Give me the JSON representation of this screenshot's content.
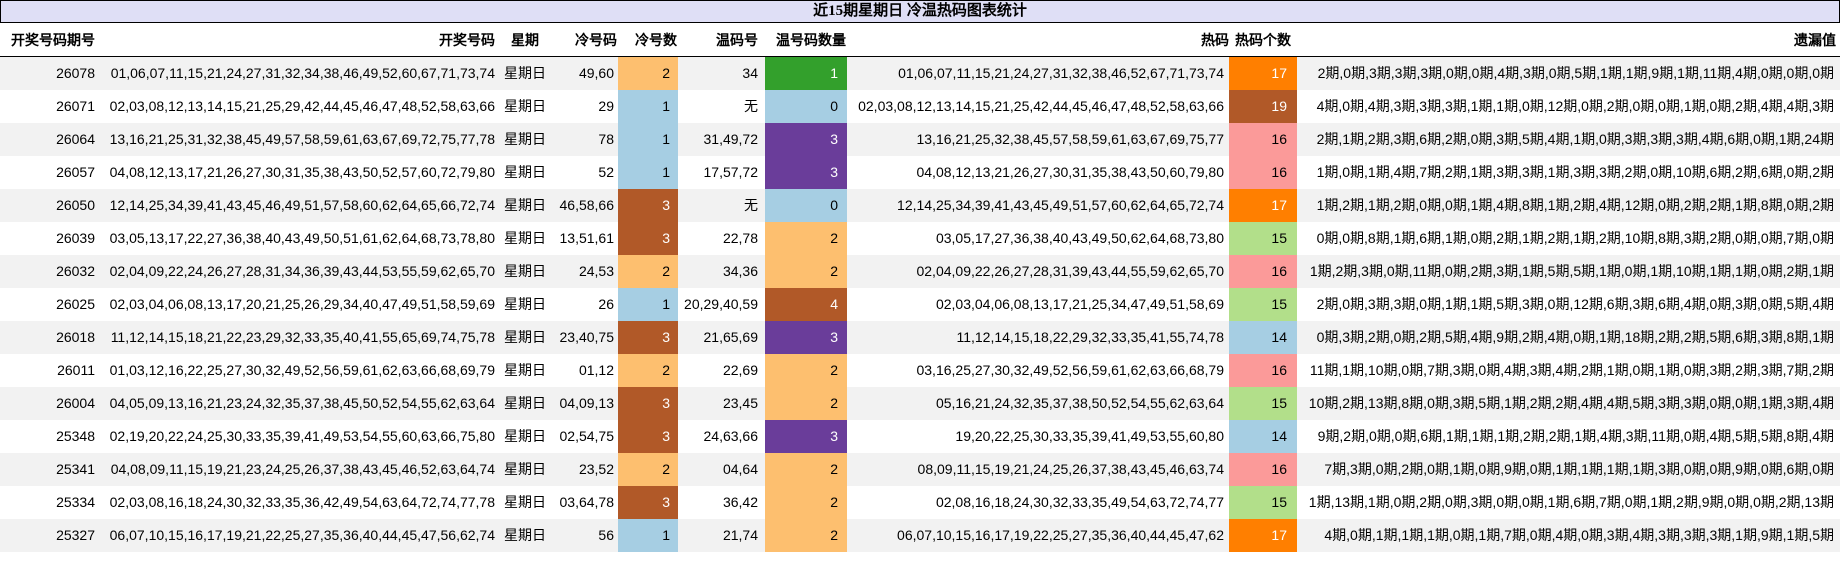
{
  "title": "近15期星期日 冷温热码图表统计",
  "columns": {
    "period": "开奖号码期号",
    "draw": "开奖号码",
    "week": "星期",
    "cold": "冷号码",
    "cold_n": "冷号数",
    "warm": "温码号",
    "warm_n": "温号码数量",
    "hot": "热码",
    "hot_n": "热码个数",
    "miss": "遗漏值"
  },
  "colors": {
    "title_bg": "#DFDFF6",
    "row_alt_bg": "#F2F2F2",
    "light_blue": "#A6CEE3",
    "light_orange": "#FDBF6F",
    "brown": "#B15928",
    "green": "#33A02C",
    "purple": "#6A3D9A",
    "light_green": "#B2DF8A",
    "salmon": "#FB9A99",
    "orange": "#FF7F00",
    "dark_backgrounds": [
      "#B15928",
      "#33A02C",
      "#6A3D9A",
      "#FF7F00"
    ]
  },
  "rows": [
    {
      "period": "26078",
      "draw": "01,06,07,11,15,21,24,27,31,32,34,38,46,49,52,60,67,71,73,74",
      "week": "星期日",
      "cold": "49,60",
      "cold_n": "2",
      "cold_color": "#FDBF6F",
      "warm": "34",
      "warm_n": "1",
      "warm_color": "#33A02C",
      "hot": "01,06,07,11,15,21,24,27,31,32,38,46,52,67,71,73,74",
      "hot_n": "17",
      "hot_color": "#FF7F00",
      "miss": "2期,0期,3期,3期,3期,0期,0期,4期,3期,0期,5期,1期,1期,9期,1期,11期,4期,0期,0期,0期"
    },
    {
      "period": "26071",
      "draw": "02,03,08,12,13,14,15,21,25,29,42,44,45,46,47,48,52,58,63,66",
      "week": "星期日",
      "cold": "29",
      "cold_n": "1",
      "cold_color": "#A6CEE3",
      "warm": "无",
      "warm_n": "0",
      "warm_color": "#A6CEE3",
      "hot": "02,03,08,12,13,14,15,21,25,42,44,45,46,47,48,52,58,63,66",
      "hot_n": "19",
      "hot_color": "#B15928",
      "miss": "4期,0期,4期,3期,3期,3期,1期,1期,0期,12期,0期,2期,0期,0期,1期,0期,2期,4期,4期,3期"
    },
    {
      "period": "26064",
      "draw": "13,16,21,25,31,32,38,45,49,57,58,59,61,63,67,69,72,75,77,78",
      "week": "星期日",
      "cold": "78",
      "cold_n": "1",
      "cold_color": "#A6CEE3",
      "warm": "31,49,72",
      "warm_n": "3",
      "warm_color": "#6A3D9A",
      "hot": "13,16,21,25,32,38,45,57,58,59,61,63,67,69,75,77",
      "hot_n": "16",
      "hot_color": "#FB9A99",
      "miss": "2期,1期,2期,3期,6期,2期,0期,3期,5期,4期,1期,0期,3期,3期,3期,4期,6期,0期,1期,24期"
    },
    {
      "period": "26057",
      "draw": "04,08,12,13,17,21,26,27,30,31,35,38,43,50,52,57,60,72,79,80",
      "week": "星期日",
      "cold": "52",
      "cold_n": "1",
      "cold_color": "#A6CEE3",
      "warm": "17,57,72",
      "warm_n": "3",
      "warm_color": "#6A3D9A",
      "hot": "04,08,12,13,21,26,27,30,31,35,38,43,50,60,79,80",
      "hot_n": "16",
      "hot_color": "#FB9A99",
      "miss": "1期,0期,1期,4期,7期,2期,1期,3期,3期,1期,3期,3期,2期,0期,10期,6期,2期,6期,0期,2期"
    },
    {
      "period": "26050",
      "draw": "12,14,25,34,39,41,43,45,46,49,51,57,58,60,62,64,65,66,72,74",
      "week": "星期日",
      "cold": "46,58,66",
      "cold_n": "3",
      "cold_color": "#B15928",
      "warm": "无",
      "warm_n": "0",
      "warm_color": "#A6CEE3",
      "hot": "12,14,25,34,39,41,43,45,49,51,57,60,62,64,65,72,74",
      "hot_n": "17",
      "hot_color": "#FF7F00",
      "miss": "1期,2期,1期,2期,0期,0期,1期,4期,8期,1期,2期,4期,12期,0期,2期,2期,1期,8期,0期,2期"
    },
    {
      "period": "26039",
      "draw": "03,05,13,17,22,27,36,38,40,43,49,50,51,61,62,64,68,73,78,80",
      "week": "星期日",
      "cold": "13,51,61",
      "cold_n": "3",
      "cold_color": "#B15928",
      "warm": "22,78",
      "warm_n": "2",
      "warm_color": "#FDBF6F",
      "hot": "03,05,17,27,36,38,40,43,49,50,62,64,68,73,80",
      "hot_n": "15",
      "hot_color": "#B2DF8A",
      "miss": "0期,0期,8期,1期,6期,1期,0期,2期,1期,2期,1期,2期,10期,8期,3期,2期,0期,0期,7期,0期"
    },
    {
      "period": "26032",
      "draw": "02,04,09,22,24,26,27,28,31,34,36,39,43,44,53,55,59,62,65,70",
      "week": "星期日",
      "cold": "24,53",
      "cold_n": "2",
      "cold_color": "#FDBF6F",
      "warm": "34,36",
      "warm_n": "2",
      "warm_color": "#FDBF6F",
      "hot": "02,04,09,22,26,27,28,31,39,43,44,55,59,62,65,70",
      "hot_n": "16",
      "hot_color": "#FB9A99",
      "miss": "1期,2期,3期,0期,11期,0期,2期,3期,1期,5期,5期,1期,0期,1期,10期,1期,1期,0期,2期,1期"
    },
    {
      "period": "26025",
      "draw": "02,03,04,06,08,13,17,20,21,25,26,29,34,40,47,49,51,58,59,69",
      "week": "星期日",
      "cold": "26",
      "cold_n": "1",
      "cold_color": "#A6CEE3",
      "warm": "20,29,40,59",
      "warm_n": "4",
      "warm_color": "#B15928",
      "hot": "02,03,04,06,08,13,17,21,25,34,47,49,51,58,69",
      "hot_n": "15",
      "hot_color": "#B2DF8A",
      "miss": "2期,0期,3期,3期,0期,1期,1期,5期,3期,0期,12期,6期,3期,6期,4期,0期,3期,0期,5期,4期"
    },
    {
      "period": "26018",
      "draw": "11,12,14,15,18,21,22,23,29,32,33,35,40,41,55,65,69,74,75,78",
      "week": "星期日",
      "cold": "23,40,75",
      "cold_n": "3",
      "cold_color": "#B15928",
      "warm": "21,65,69",
      "warm_n": "3",
      "warm_color": "#6A3D9A",
      "hot": "11,12,14,15,18,22,29,32,33,35,41,55,74,78",
      "hot_n": "14",
      "hot_color": "#A6CEE3",
      "miss": "0期,3期,2期,0期,2期,5期,4期,9期,2期,4期,0期,1期,18期,2期,2期,5期,6期,3期,8期,1期"
    },
    {
      "period": "26011",
      "draw": "01,03,12,16,22,25,27,30,32,49,52,56,59,61,62,63,66,68,69,79",
      "week": "星期日",
      "cold": "01,12",
      "cold_n": "2",
      "cold_color": "#FDBF6F",
      "warm": "22,69",
      "warm_n": "2",
      "warm_color": "#FDBF6F",
      "hot": "03,16,25,27,30,32,49,52,56,59,61,62,63,66,68,79",
      "hot_n": "16",
      "hot_color": "#FB9A99",
      "miss": "11期,1期,10期,0期,7期,3期,0期,4期,3期,4期,2期,1期,0期,1期,0期,3期,2期,3期,7期,2期"
    },
    {
      "period": "26004",
      "draw": "04,05,09,13,16,21,23,24,32,35,37,38,45,50,52,54,55,62,63,64",
      "week": "星期日",
      "cold": "04,09,13",
      "cold_n": "3",
      "cold_color": "#B15928",
      "warm": "23,45",
      "warm_n": "2",
      "warm_color": "#FDBF6F",
      "hot": "05,16,21,24,32,35,37,38,50,52,54,55,62,63,64",
      "hot_n": "15",
      "hot_color": "#B2DF8A",
      "miss": "10期,2期,13期,8期,0期,3期,5期,1期,2期,2期,4期,4期,5期,3期,3期,0期,0期,1期,3期,4期"
    },
    {
      "period": "25348",
      "draw": "02,19,20,22,24,25,30,33,35,39,41,49,53,54,55,60,63,66,75,80",
      "week": "星期日",
      "cold": "02,54,75",
      "cold_n": "3",
      "cold_color": "#B15928",
      "warm": "24,63,66",
      "warm_n": "3",
      "warm_color": "#6A3D9A",
      "hot": "19,20,22,25,30,33,35,39,41,49,53,55,60,80",
      "hot_n": "14",
      "hot_color": "#A6CEE3",
      "miss": "9期,2期,0期,0期,6期,1期,1期,1期,2期,2期,1期,4期,3期,11期,0期,4期,5期,5期,8期,4期"
    },
    {
      "period": "25341",
      "draw": "04,08,09,11,15,19,21,23,24,25,26,37,38,43,45,46,52,63,64,74",
      "week": "星期日",
      "cold": "23,52",
      "cold_n": "2",
      "cold_color": "#FDBF6F",
      "warm": "04,64",
      "warm_n": "2",
      "warm_color": "#FDBF6F",
      "hot": "08,09,11,15,19,21,24,25,26,37,38,43,45,46,63,74",
      "hot_n": "16",
      "hot_color": "#FB9A99",
      "miss": "7期,3期,0期,2期,0期,1期,0期,9期,0期,1期,1期,1期,1期,3期,0期,0期,9期,0期,6期,0期"
    },
    {
      "period": "25334",
      "draw": "02,03,08,16,18,24,30,32,33,35,36,42,49,54,63,64,72,74,77,78",
      "week": "星期日",
      "cold": "03,64,78",
      "cold_n": "3",
      "cold_color": "#B15928",
      "warm": "36,42",
      "warm_n": "2",
      "warm_color": "#FDBF6F",
      "hot": "02,08,16,18,24,30,32,33,35,49,54,63,72,74,77",
      "hot_n": "15",
      "hot_color": "#B2DF8A",
      "miss": "1期,13期,1期,0期,2期,0期,3期,0期,0期,1期,6期,7期,0期,1期,2期,9期,0期,0期,2期,13期"
    },
    {
      "period": "25327",
      "draw": "06,07,10,15,16,17,19,21,22,25,27,35,36,40,44,45,47,56,62,74",
      "week": "星期日",
      "cold": "56",
      "cold_n": "1",
      "cold_color": "#A6CEE3",
      "warm": "21,74",
      "warm_n": "2",
      "warm_color": "#FDBF6F",
      "hot": "06,07,10,15,16,17,19,22,25,27,35,36,40,44,45,47,62",
      "hot_n": "17",
      "hot_color": "#FF7F00",
      "miss": "4期,0期,1期,1期,1期,0期,1期,7期,0期,4期,0期,3期,4期,3期,3期,3期,1期,9期,1期,5期"
    }
  ]
}
